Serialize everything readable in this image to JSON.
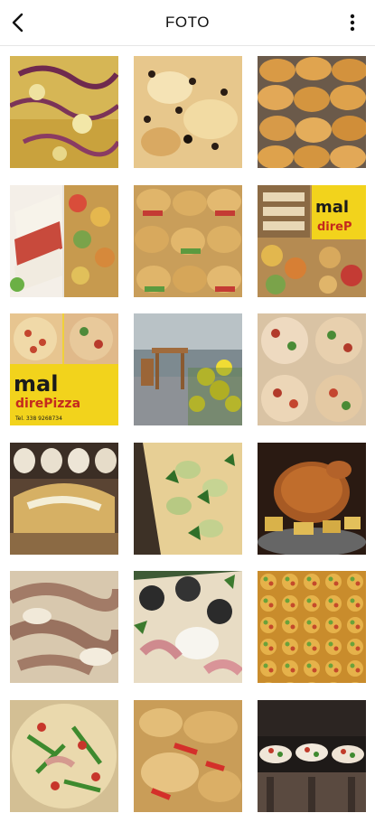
{
  "header": {
    "title": "FOTO",
    "back_icon": "chevron-left-icon",
    "menu_icon": "more-vertical-icon"
  },
  "photos": [
    {
      "subject": "pizza-onion"
    },
    {
      "subject": "focaccia-olives"
    },
    {
      "subject": "croissants"
    },
    {
      "subject": "sandwiches-collage"
    },
    {
      "subject": "mini-sandwiches"
    },
    {
      "subject": "mal-dire-pizza-collage"
    },
    {
      "subject": "mal-dire-pizza-sign",
      "sign_text": "mal dire Pizza",
      "sign_phone": "Tel. 338 9268734"
    },
    {
      "subject": "terrace-flowers"
    },
    {
      "subject": "pizza-collage"
    },
    {
      "subject": "calzone"
    },
    {
      "subject": "pizza-zucchini"
    },
    {
      "subject": "roast-chicken"
    },
    {
      "subject": "pizza-ham"
    },
    {
      "subject": "pizza-aubergine"
    },
    {
      "subject": "pizza-pattern"
    },
    {
      "subject": "pizza-arugula"
    },
    {
      "subject": "focaccia-peppers"
    },
    {
      "subject": "pizza-plates"
    }
  ],
  "colors": {
    "header_bg": "#ffffff",
    "divider": "#e6e6e6",
    "text": "#111111"
  }
}
